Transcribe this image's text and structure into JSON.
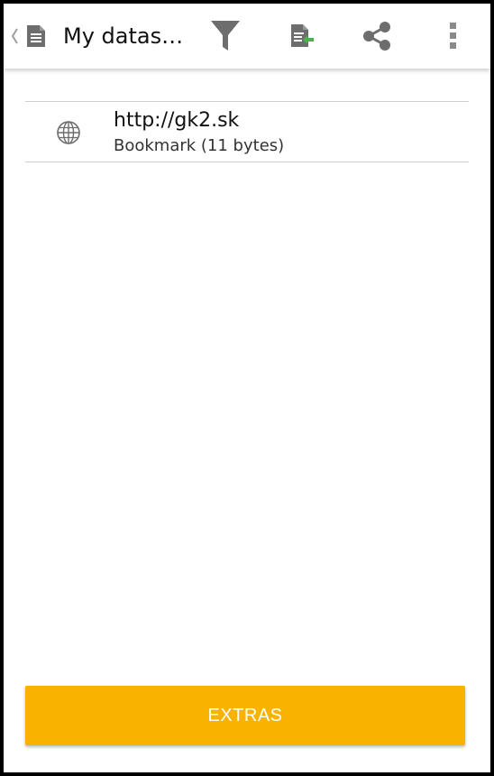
{
  "toolbar": {
    "title": "My datas…",
    "actions": {
      "filter": "filter-icon",
      "export": "export-document-icon",
      "share": "share-icon",
      "more": "more-vert-icon"
    },
    "icon_color": "#6d6d6d",
    "accent_green": "#4caf50"
  },
  "list": {
    "items": [
      {
        "icon": "globe-icon",
        "title": "http://gk2.sk",
        "subtitle": "Bookmark (11 bytes)"
      }
    ]
  },
  "footer": {
    "extras_label": "EXTRAS",
    "button_color": "#f9b200"
  }
}
